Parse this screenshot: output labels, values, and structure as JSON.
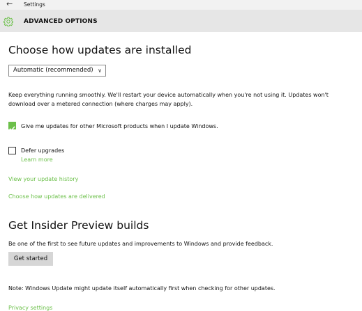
{
  "window": {
    "title": "Settings"
  },
  "header": {
    "title": "ADVANCED OPTIONS",
    "icon": "gear-icon"
  },
  "updates": {
    "heading": "Choose how updates are installed",
    "install_mode": {
      "selected": "Automatic (recommended)"
    },
    "description": "Keep everything running smoothly. We'll restart your device automatically when you're not using it. Updates won't download over a metered connection (where charges may apply).",
    "ms_products": {
      "label": "Give me updates for other Microsoft products when I update Windows.",
      "checked": true
    },
    "defer": {
      "label": "Defer upgrades",
      "checked": false,
      "learn_more": "Learn more"
    },
    "history_link": "View your update history",
    "delivery_link": "Choose how updates are delivered"
  },
  "insider": {
    "heading": "Get Insider Preview builds",
    "description": "Be one of the first to see future updates and improvements to Windows and provide feedback.",
    "button": "Get started"
  },
  "note": "Note: Windows Update might update itself automatically first when checking for other updates.",
  "privacy_link": "Privacy settings",
  "colors": {
    "accent": "#6cc04a",
    "header_bg": "#e6e6e6",
    "button_bg": "#d6d6d6"
  }
}
